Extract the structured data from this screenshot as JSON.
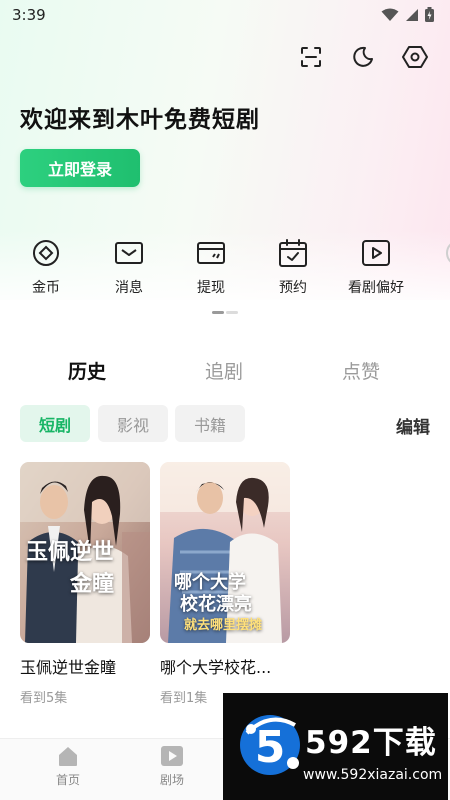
{
  "status_bar": {
    "time": "3:39"
  },
  "header": {
    "icons": [
      "scan-icon",
      "moon-icon",
      "settings-hexagon-icon"
    ]
  },
  "welcome": {
    "title": "欢迎来到木叶免费短剧",
    "login_button": "立即登录"
  },
  "quick_menu": [
    {
      "label": "金币",
      "icon": "coin-icon"
    },
    {
      "label": "消息",
      "icon": "mail-icon"
    },
    {
      "label": "提现",
      "icon": "wallet-icon"
    },
    {
      "label": "预约",
      "icon": "calendar-check-icon"
    },
    {
      "label": "看剧偏好",
      "icon": "play-icon"
    }
  ],
  "tabs": [
    {
      "label": "历史",
      "active": true
    },
    {
      "label": "追剧",
      "active": false
    },
    {
      "label": "点赞",
      "active": false
    }
  ],
  "filters": {
    "chips": [
      {
        "label": "短剧",
        "active": true
      },
      {
        "label": "影视",
        "active": false
      },
      {
        "label": "书籍",
        "active": false
      }
    ],
    "edit_label": "编辑"
  },
  "history": [
    {
      "title": "玉佩逆世金瞳",
      "progress": "看到5集",
      "cover_text": [
        "玉佩逆世",
        "金瞳"
      ]
    },
    {
      "title": "哪个大学校花...",
      "progress": "看到1集",
      "cover_text": [
        "哪个大学",
        "校花漂亮",
        "就去哪里摆摊"
      ]
    }
  ],
  "bottom_nav": [
    {
      "label": "首页",
      "icon": "home-icon"
    },
    {
      "label": "剧场",
      "icon": "theater-play-icon"
    }
  ],
  "watermark": {
    "brand": "592下载",
    "url": "www.592xiazai.com",
    "logo_digit": "5"
  },
  "colors": {
    "accent": "#1fbf6f",
    "chip_active_bg": "#e3f6ec",
    "text_muted": "#999999"
  }
}
